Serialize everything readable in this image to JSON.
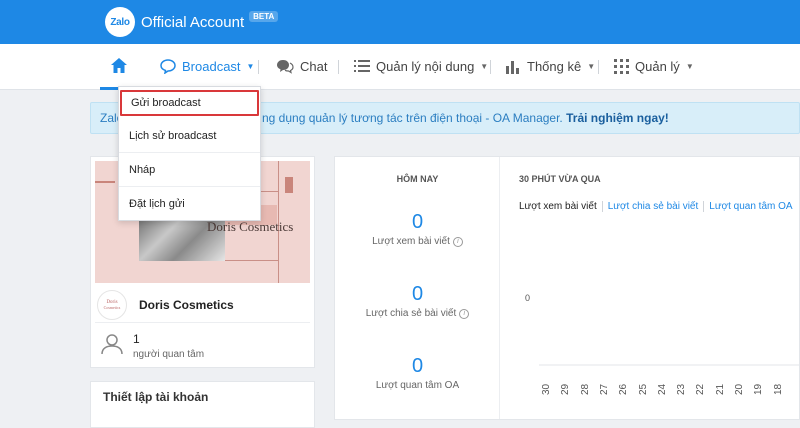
{
  "brand": {
    "logo_text": "Zalo",
    "name": "Official Account",
    "beta": "BETA"
  },
  "nav": {
    "items": [
      {
        "label": "Broadcast",
        "icon": "broadcast-icon",
        "dropdown": true,
        "active": true
      },
      {
        "label": "Chat",
        "icon": "chat-icon"
      },
      {
        "label": "Quản lý nội dung",
        "icon": "list-icon",
        "dropdown": true
      },
      {
        "label": "Thống kê",
        "icon": "bar-chart-icon",
        "dropdown": true
      },
      {
        "label": "Quản lý",
        "icon": "grid-icon",
        "dropdown": true
      }
    ]
  },
  "broadcast_menu": {
    "items": [
      {
        "label": "Gửi broadcast",
        "highlighted": true
      },
      {
        "label": "Lịch sử broadcast"
      },
      {
        "label": "Nháp"
      },
      {
        "label": "Đặt lịch gửi"
      }
    ]
  },
  "banner": {
    "left_text": "Zalo",
    "text": "ng dụng quản lý tương tác trên điện thoại - OA Manager.",
    "cta": "Trải nghiệm ngay!"
  },
  "profile": {
    "cover_title": "Doris Cosmetics",
    "avatar_line1": "Doris",
    "avatar_line2": "Cosmetics",
    "name": "Doris Cosmetics",
    "followers_count": "1",
    "followers_label": "người quan tâm"
  },
  "account_setup": {
    "title": "Thiết lập tài khoản"
  },
  "today": {
    "title": "HÔM NAY",
    "stats": [
      {
        "value": "0",
        "label": "Lượt xem bài viết"
      },
      {
        "value": "0",
        "label": "Lượt chia sẻ bài viết"
      },
      {
        "value": "0",
        "label": "Lượt quan tâm OA"
      }
    ]
  },
  "recent": {
    "title": "30 PHÚT VỪA QUA",
    "tabs": [
      "Lượt xem bài viết",
      "Lượt chia sẻ bài viết",
      "Lượt quan tâm OA"
    ],
    "active_tab": 0,
    "y_tick": "0",
    "x_ticks": [
      "30",
      "29",
      "28",
      "27",
      "26",
      "25",
      "24",
      "23",
      "22",
      "21",
      "20",
      "19",
      "18"
    ]
  },
  "colors": {
    "topbar": "#1e88e5",
    "accent": "#1e88e5",
    "highlight_border": "#d9383a",
    "banner_bg": "#d8eef9"
  }
}
